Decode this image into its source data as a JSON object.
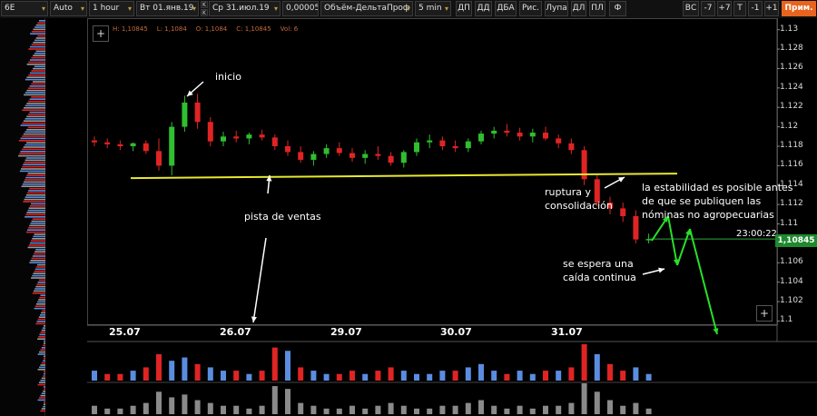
{
  "toolbar": {
    "symbol": "6E",
    "chart_type": "Auto",
    "timeframe": "1 hour",
    "date_from": "Вт 01.янв.19",
    "k_top": "K",
    "k_bottom": "K",
    "date_to": "Ср 31.июл.19",
    "tick": "0,00005",
    "indicator": "Объём-ДельтаПроф",
    "interval": "5 min",
    "buttons": [
      "ДП",
      "ДД",
      "ДБА",
      "Рис.",
      "Лупа",
      "ДЛ",
      "ПЛ",
      "Ф"
    ],
    "right_buttons": [
      "ВС",
      "-7",
      "+7",
      "T",
      "-1",
      "+1"
    ],
    "apply_label": "Прим."
  },
  "ohlc": {
    "high": "H: 1,10845",
    "low": "L: 1,1084",
    "open": "O: 1,1084",
    "close": "C: 1,10845",
    "volume": "Vol: 6"
  },
  "plus_label": "+",
  "price_axis": [
    "1.13",
    "1.128",
    "1.126",
    "1.124",
    "1.122",
    "1.12",
    "1.118",
    "1.116",
    "1.114",
    "1.112",
    "1.11",
    "1.108",
    "1.106",
    "1.104",
    "1.102",
    "1.1"
  ],
  "time_axis": [
    "25.07",
    "26.07",
    "29.07",
    "30.07",
    "31.07"
  ],
  "current_price": "1,10845",
  "countdown": "23:00:22",
  "annotations": {
    "inicio": "inicio",
    "pista": "pista de ventas",
    "ruptura": "ruptura y consolidación",
    "estabilidad": "la estabilidad es posible antes de que se publiquen las nóminas no agropecuarias",
    "caida": "se espera una caída continua"
  },
  "colors": {
    "bull": "#2fbf2f",
    "bear": "#e02424",
    "support_line": "#e8e830",
    "volume_blue": "#5a8de0",
    "accent": "#e8641e",
    "forecast_arrow": "#28e028"
  },
  "chart_data": {
    "type": "candlestick",
    "title": "",
    "x": [
      "25.07",
      "26.07",
      "29.07",
      "30.07",
      "31.07"
    ],
    "ylim": [
      1.1,
      1.13
    ],
    "support_level": 1.115,
    "current": 1.10845,
    "candles": [
      {
        "t": "25.07",
        "o": 1.1186,
        "h": 1.119,
        "l": 1.118,
        "c": 1.1184
      },
      {
        "t": "25.07",
        "o": 1.1184,
        "h": 1.1188,
        "l": 1.1178,
        "c": 1.1182
      },
      {
        "t": "25.07",
        "o": 1.1182,
        "h": 1.1186,
        "l": 1.1176,
        "c": 1.118
      },
      {
        "t": "25.07",
        "o": 1.118,
        "h": 1.1184,
        "l": 1.1175,
        "c": 1.1183
      },
      {
        "t": "25.07",
        "o": 1.1183,
        "h": 1.1186,
        "l": 1.1172,
        "c": 1.1175
      },
      {
        "t": "25.07",
        "o": 1.1175,
        "h": 1.1188,
        "l": 1.1155,
        "c": 1.116
      },
      {
        "t": "25.07",
        "o": 1.116,
        "h": 1.1205,
        "l": 1.115,
        "c": 1.12
      },
      {
        "t": "25.07",
        "o": 1.12,
        "h": 1.1232,
        "l": 1.1195,
        "c": 1.1225
      },
      {
        "t": "25.07",
        "o": 1.1225,
        "h": 1.1234,
        "l": 1.1198,
        "c": 1.1205
      },
      {
        "t": "25.07",
        "o": 1.1205,
        "h": 1.121,
        "l": 1.118,
        "c": 1.1185
      },
      {
        "t": "26.07",
        "o": 1.1185,
        "h": 1.1195,
        "l": 1.118,
        "c": 1.119
      },
      {
        "t": "26.07",
        "o": 1.119,
        "h": 1.1196,
        "l": 1.1184,
        "c": 1.1188
      },
      {
        "t": "26.07",
        "o": 1.1188,
        "h": 1.1194,
        "l": 1.1182,
        "c": 1.1192
      },
      {
        "t": "26.07",
        "o": 1.1192,
        "h": 1.1197,
        "l": 1.1186,
        "c": 1.1189
      },
      {
        "t": "26.07",
        "o": 1.1189,
        "h": 1.1192,
        "l": 1.1176,
        "c": 1.118
      },
      {
        "t": "26.07",
        "o": 1.118,
        "h": 1.1186,
        "l": 1.117,
        "c": 1.1174
      },
      {
        "t": "26.07",
        "o": 1.1174,
        "h": 1.118,
        "l": 1.1163,
        "c": 1.1166
      },
      {
        "t": "26.07",
        "o": 1.1166,
        "h": 1.1175,
        "l": 1.116,
        "c": 1.1172
      },
      {
        "t": "29.07",
        "o": 1.1172,
        "h": 1.1182,
        "l": 1.1168,
        "c": 1.1178
      },
      {
        "t": "29.07",
        "o": 1.1178,
        "h": 1.1184,
        "l": 1.117,
        "c": 1.1173
      },
      {
        "t": "29.07",
        "o": 1.1173,
        "h": 1.1178,
        "l": 1.1164,
        "c": 1.1168
      },
      {
        "t": "29.07",
        "o": 1.1168,
        "h": 1.1176,
        "l": 1.1162,
        "c": 1.1172
      },
      {
        "t": "29.07",
        "o": 1.1172,
        "h": 1.118,
        "l": 1.1166,
        "c": 1.117
      },
      {
        "t": "29.07",
        "o": 1.117,
        "h": 1.1174,
        "l": 1.116,
        "c": 1.1163
      },
      {
        "t": "29.07",
        "o": 1.1163,
        "h": 1.1176,
        "l": 1.1158,
        "c": 1.1174
      },
      {
        "t": "29.07",
        "o": 1.1174,
        "h": 1.1188,
        "l": 1.117,
        "c": 1.1184
      },
      {
        "t": "30.07",
        "o": 1.1184,
        "h": 1.1192,
        "l": 1.1178,
        "c": 1.1186
      },
      {
        "t": "30.07",
        "o": 1.1186,
        "h": 1.119,
        "l": 1.1176,
        "c": 1.118
      },
      {
        "t": "30.07",
        "o": 1.118,
        "h": 1.1186,
        "l": 1.1174,
        "c": 1.1178
      },
      {
        "t": "30.07",
        "o": 1.1178,
        "h": 1.1188,
        "l": 1.1174,
        "c": 1.1185
      },
      {
        "t": "30.07",
        "o": 1.1185,
        "h": 1.1196,
        "l": 1.1182,
        "c": 1.1193
      },
      {
        "t": "30.07",
        "o": 1.1193,
        "h": 1.12,
        "l": 1.1188,
        "c": 1.1196
      },
      {
        "t": "30.07",
        "o": 1.1196,
        "h": 1.1203,
        "l": 1.119,
        "c": 1.1194
      },
      {
        "t": "30.07",
        "o": 1.1194,
        "h": 1.1199,
        "l": 1.1186,
        "c": 1.119
      },
      {
        "t": "31.07",
        "o": 1.119,
        "h": 1.1198,
        "l": 1.1184,
        "c": 1.1194
      },
      {
        "t": "31.07",
        "o": 1.1194,
        "h": 1.12,
        "l": 1.1186,
        "c": 1.1188
      },
      {
        "t": "31.07",
        "o": 1.1188,
        "h": 1.1192,
        "l": 1.1178,
        "c": 1.1183
      },
      {
        "t": "31.07",
        "o": 1.1183,
        "h": 1.1188,
        "l": 1.1172,
        "c": 1.1176
      },
      {
        "t": "31.07",
        "o": 1.1176,
        "h": 1.118,
        "l": 1.114,
        "c": 1.1146
      },
      {
        "t": "31.07",
        "o": 1.1146,
        "h": 1.115,
        "l": 1.1118,
        "c": 1.1122
      },
      {
        "t": "31.07",
        "o": 1.1122,
        "h": 1.1128,
        "l": 1.111,
        "c": 1.1116
      },
      {
        "t": "31.07",
        "o": 1.1116,
        "h": 1.1122,
        "l": 1.1102,
        "c": 1.1108
      },
      {
        "t": "31.07",
        "o": 1.1108,
        "h": 1.1114,
        "l": 1.108,
        "c": 1.1084
      },
      {
        "t": "31.07",
        "o": 1.1084,
        "h": 1.109,
        "l": 1.108,
        "c": 1.10845
      }
    ],
    "volume": [
      3,
      2,
      2,
      3,
      4,
      8,
      6,
      7,
      5,
      4,
      3,
      3,
      2,
      3,
      10,
      9,
      4,
      3,
      2,
      2,
      3,
      2,
      3,
      4,
      3,
      2,
      2,
      3,
      3,
      4,
      5,
      3,
      2,
      3,
      2,
      3,
      3,
      4,
      11,
      8,
      5,
      3,
      4,
      2
    ],
    "forecast_path": [
      [
        1.1084,
        0
      ],
      [
        1.1108,
        1
      ],
      [
        1.1068,
        2
      ],
      [
        1.1105,
        3
      ],
      [
        1.099,
        4
      ]
    ]
  }
}
